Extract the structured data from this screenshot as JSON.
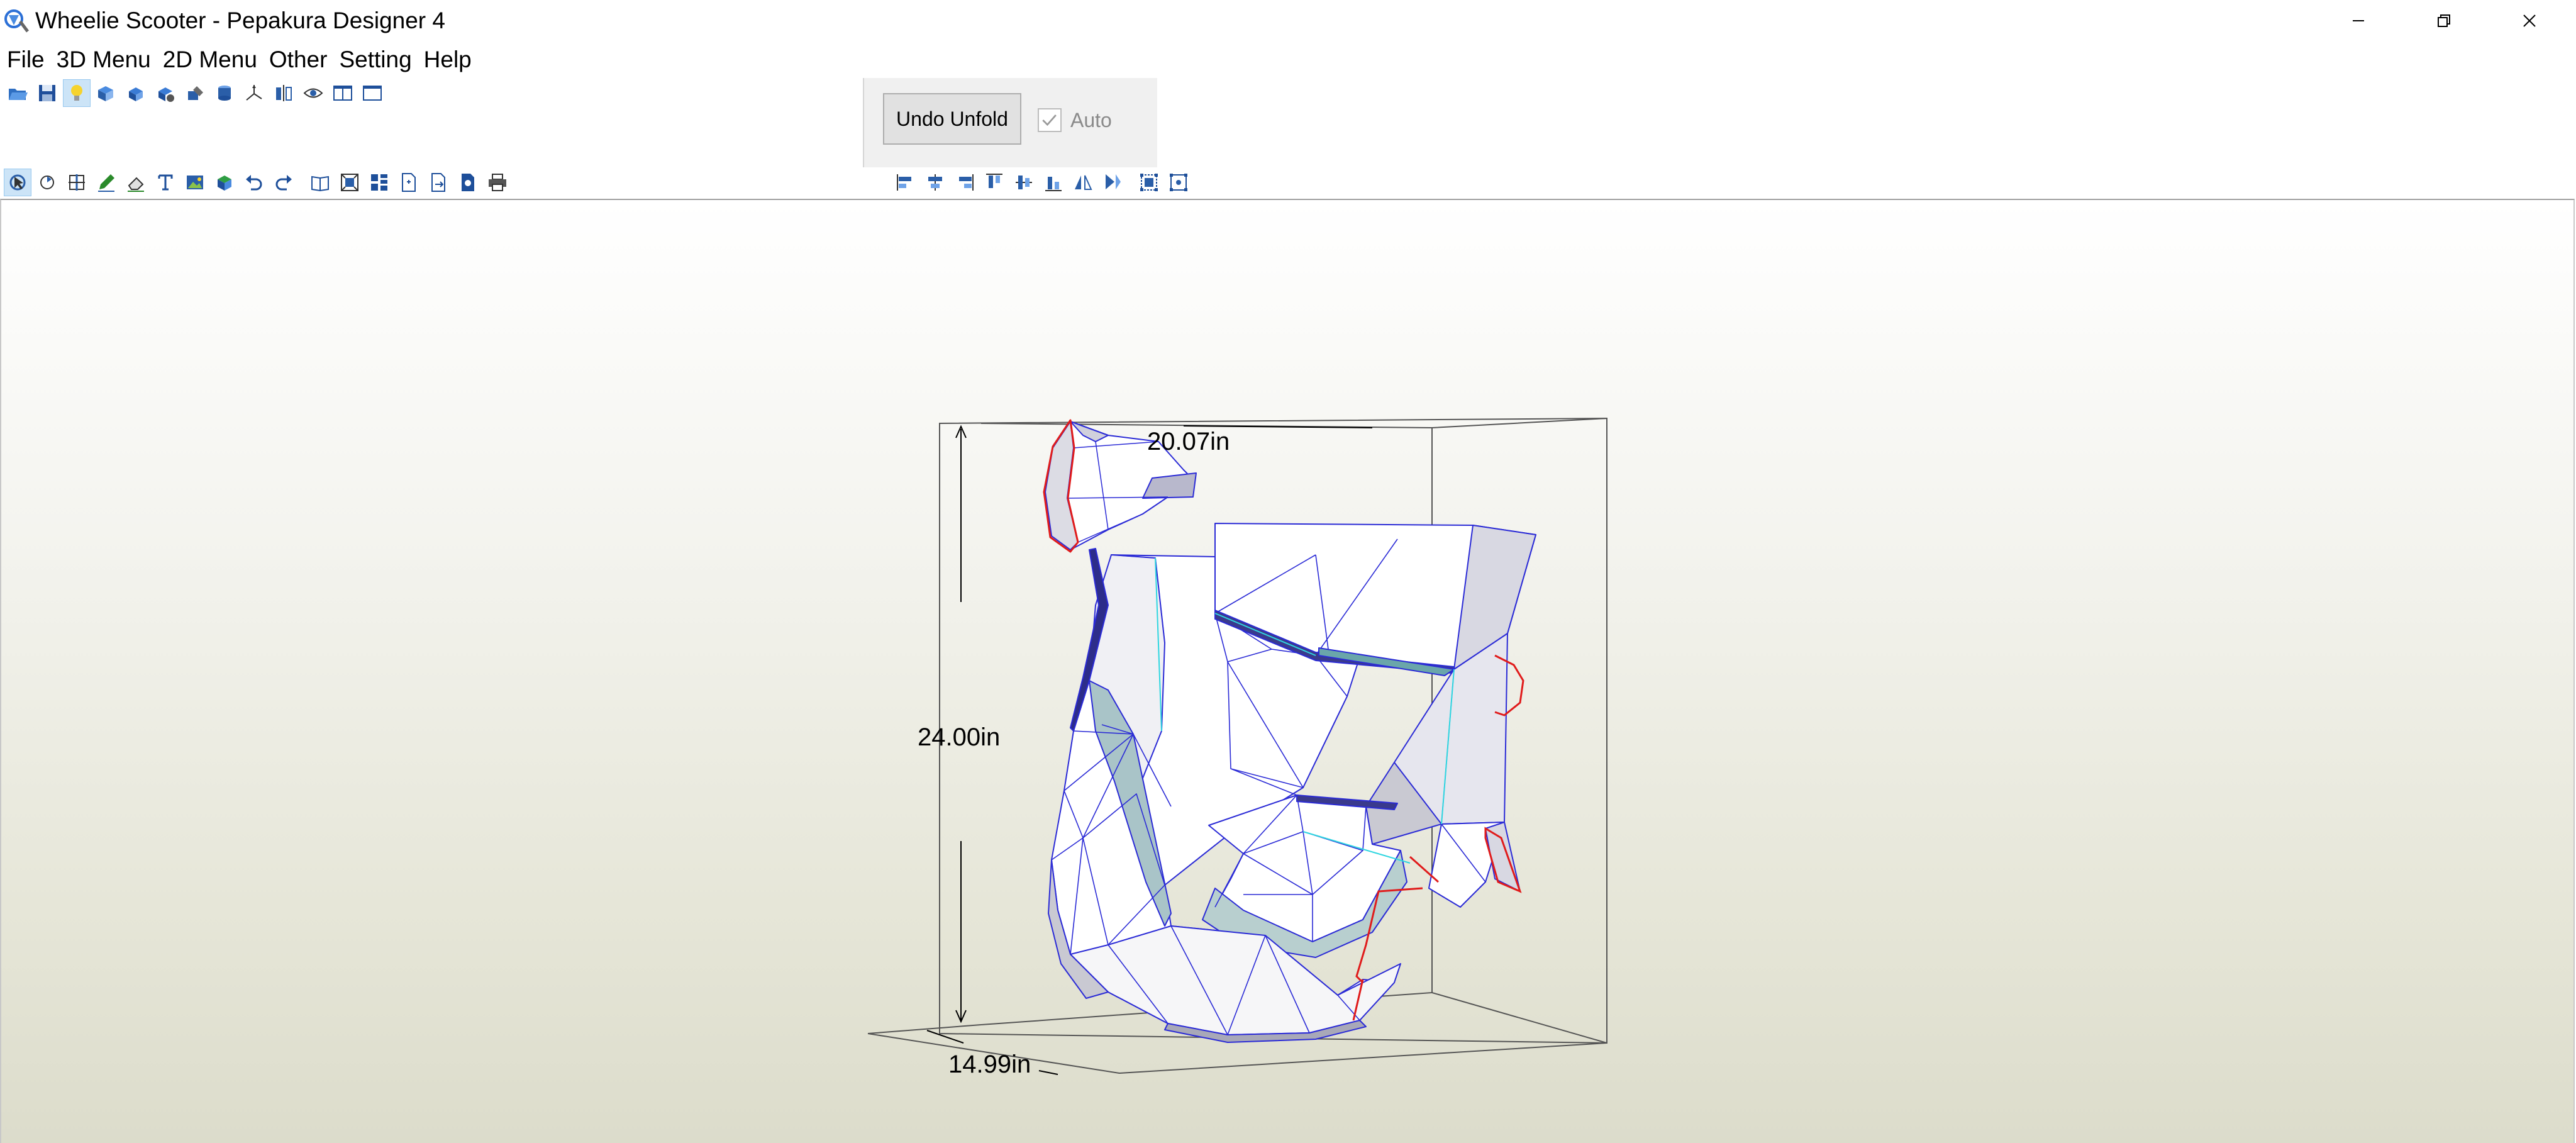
{
  "window": {
    "title": "Wheelie Scooter - Pepakura Designer 4"
  },
  "menu": [
    "File",
    "3D Menu",
    "2D Menu",
    "Other",
    "Setting",
    "Help"
  ],
  "unfold_panel": {
    "undo_label": "Undo Unfold",
    "auto_label": "Auto",
    "auto_checked": true
  },
  "toolbar_top": [
    "open-file-icon",
    "save-icon",
    "light-bulb-icon",
    "unfold-icon",
    "rotate-model-icon",
    "move-part-icon",
    "edit-part-icon",
    "cylinder-icon",
    "axis-icon",
    "mirror-icon",
    "view-eye-icon",
    "split-view-icon",
    "single-view-icon"
  ],
  "toolbar_3d": [
    "select-icon",
    "rotate-edge-icon",
    "join-edge-icon",
    "pencil-icon",
    "eraser-icon",
    "text-icon",
    "image-icon",
    "color-icon",
    "undo-icon",
    "redo-icon",
    "book-icon",
    "fit-view-icon",
    "grid-icon",
    "new-page-icon",
    "export-page-icon",
    "print-preview-icon",
    "print-icon"
  ],
  "toolbar_align": [
    "align-left-icon",
    "align-center-icon",
    "align-right-icon",
    "align-top-icon",
    "align-middle-icon",
    "align-bottom-icon",
    "flip-horizontal-icon",
    "flip-vertical-icon",
    "group-icon",
    "ungroup-icon"
  ],
  "dimensions": {
    "width": "20.07in",
    "height": "24.00in",
    "depth": "14.99in"
  },
  "colors": {
    "mesh_edge": "#2b2bd6",
    "cut_edge": "#e01b1b",
    "fold_edge": "#2fd6e0",
    "face": "#ffffff",
    "shadow_face": "#c9c9d2"
  }
}
